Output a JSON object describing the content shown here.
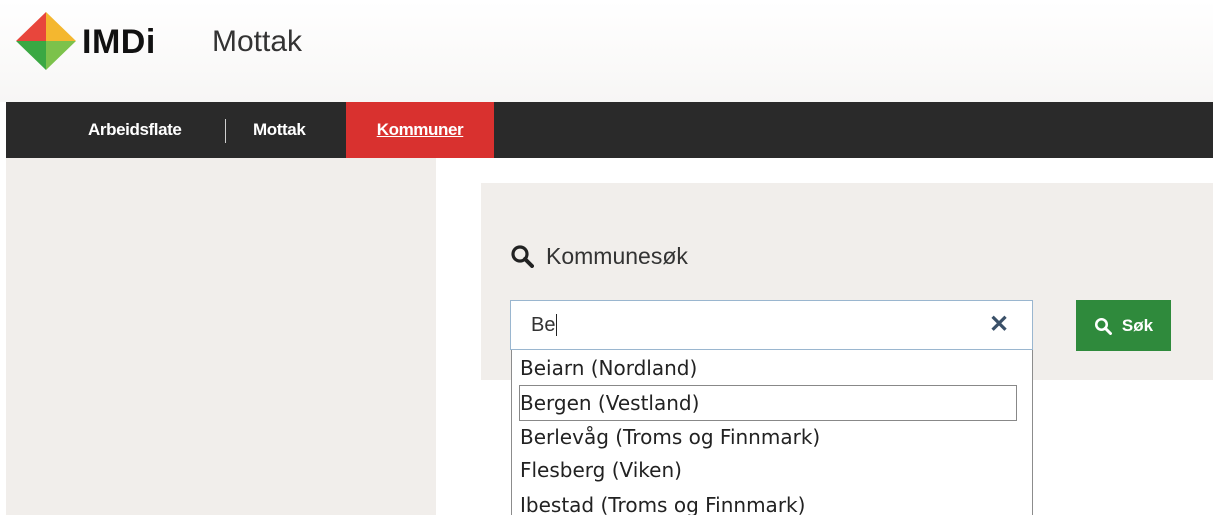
{
  "brand": {
    "name": "IMDi",
    "app_title": "Mottak"
  },
  "nav": {
    "items": [
      {
        "label": "Arbeidsflate"
      },
      {
        "label": "Mottak"
      },
      {
        "label": "Kommuner",
        "active": true
      }
    ],
    "active_color": "#d9312f",
    "background": "#2a2a2a"
  },
  "search": {
    "heading": "Kommunesøk",
    "value": "Be",
    "clear_icon": "close-icon",
    "button_label": "Søk",
    "button_color": "#2f8a3c"
  },
  "suggestions": [
    {
      "label": "Beiarn (Nordland)"
    },
    {
      "label": "Bergen (Vestland)",
      "highlighted": true
    },
    {
      "label": "Berlevåg (Troms og Finnmark)"
    },
    {
      "label": "Flesberg (Viken)"
    },
    {
      "label": "Ibestad (Troms og Finnmark)"
    }
  ]
}
